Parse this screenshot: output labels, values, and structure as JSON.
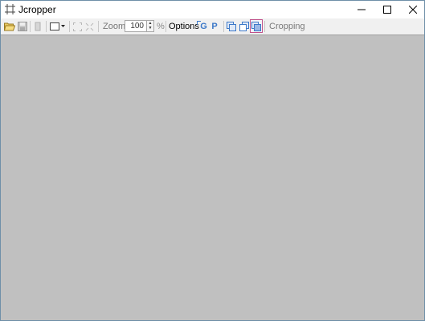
{
  "window": {
    "title": "Jcropper"
  },
  "titlebar_icons": {
    "app": "jcropper-app-icon",
    "minimize": "minimize-icon",
    "maximize": "maximize-icon",
    "close": "close-icon"
  },
  "toolbar": {
    "zoom_label": "Zoom:",
    "zoom_value": "100",
    "zoom_unit": "%",
    "options_label": "Options",
    "g_label": "G",
    "p_label": "P",
    "mode_label": "Cropping"
  },
  "colors": {
    "workarea": "#c0c0c0",
    "active_button_border": "#c0508a",
    "accent_blue": "#3c78c8"
  }
}
